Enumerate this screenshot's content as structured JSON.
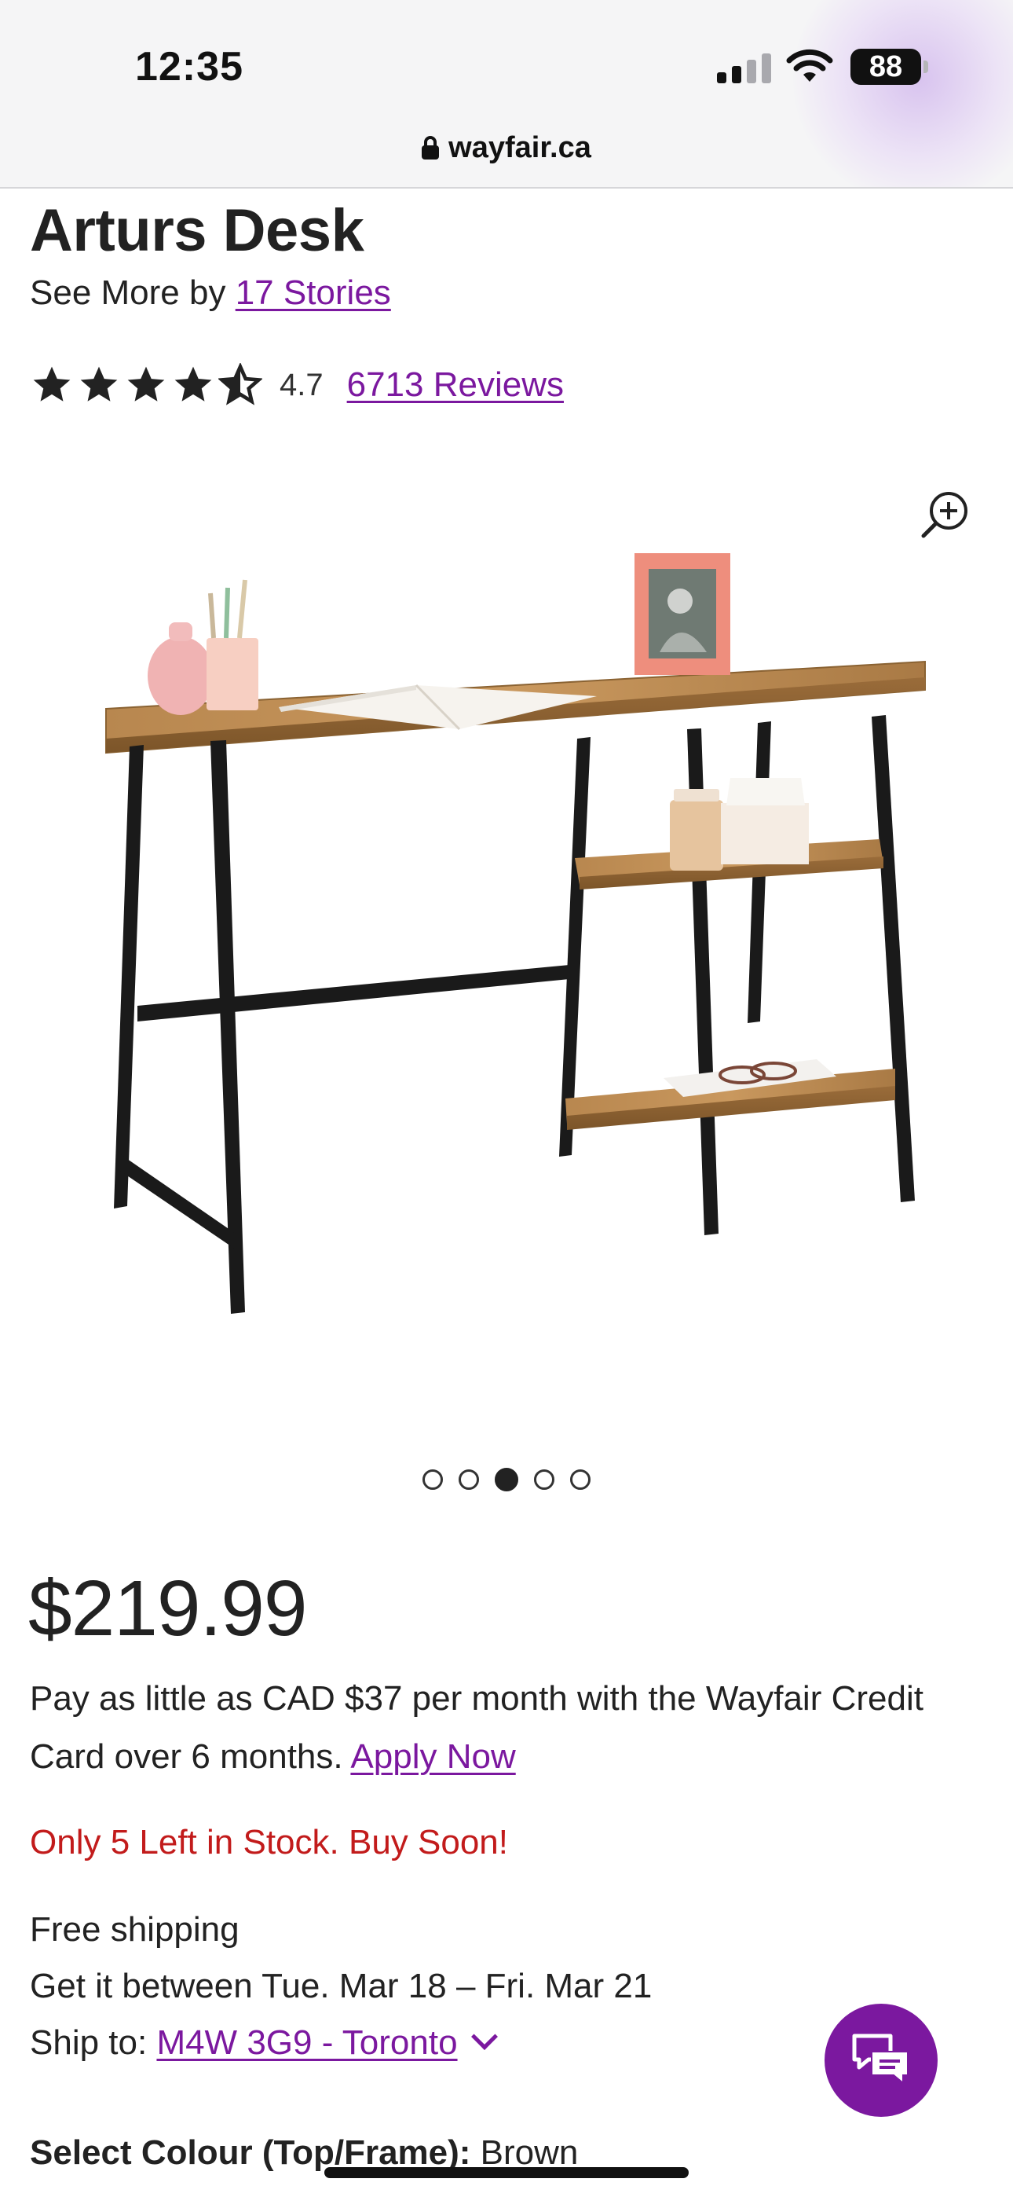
{
  "status_bar": {
    "time": "12:35",
    "battery": "88"
  },
  "browser": {
    "url": "wayfair.ca"
  },
  "product": {
    "title": "Arturs Desk",
    "brand_prefix": "See More by ",
    "brand": "17 Stories",
    "rating": "4.7",
    "rating_stars_value": 4.5,
    "reviews": "6713 Reviews",
    "price": "$219.99",
    "financing_text": "Pay as little as CAD $37 per month with the Wayfair Credit Card over 6 months. ",
    "apply_link": "Apply Now",
    "stock_text": "Only 5 Left in Stock. Buy Soon!",
    "shipping_line": "Free shipping",
    "delivery_line": "Get it between Tue. Mar 18 – Fri. Mar 21",
    "ship_to_label": "Ship to: ",
    "ship_to_location": "M4W 3G9 - Toronto",
    "select_colour_label": "Select Colour (Top/Frame):",
    "select_colour_value": " Brown"
  },
  "carousel": {
    "total": 5,
    "active_index": 2
  },
  "icons": {
    "zoom": "zoom-in-icon",
    "chat": "chat-icon",
    "lock": "lock-icon",
    "chevron": "chevron-down-icon"
  },
  "colors": {
    "link": "#7b189f",
    "stock_warning": "#c21b1b",
    "chat_button": "#7b189f"
  }
}
